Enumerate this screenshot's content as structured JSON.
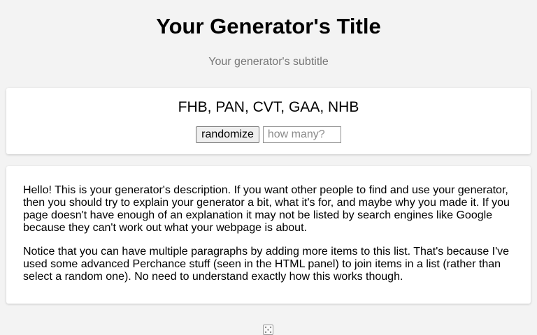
{
  "header": {
    "title": "Your Generator's Title",
    "subtitle": "Your generator's subtitle"
  },
  "output": {
    "text": "FHB, PAN, CVT, GAA, NHB"
  },
  "controls": {
    "randomize_label": "randomize",
    "count_placeholder": "how many?"
  },
  "description": {
    "paragraphs": [
      "Hello! This is your generator's description. If you want other people to find and use your generator, then you should try to explain your generator a bit, what it's for, and maybe why you made it. If you page doesn't have enough of an explanation it may not be listed by search engines like Google because they can't work out what your webpage is about.",
      "Notice that you can have multiple paragraphs by adding more items to this list. That's because I've used some advanced Perchance stuff (seen in the HTML panel) to join items in a list (rather than select a random one). No need to understand exactly how this works though."
    ]
  },
  "footer": {
    "icon": "dice-icon"
  },
  "colors": {
    "background": "#f3f3f3",
    "card": "#ffffff",
    "subtitle": "#777777"
  }
}
